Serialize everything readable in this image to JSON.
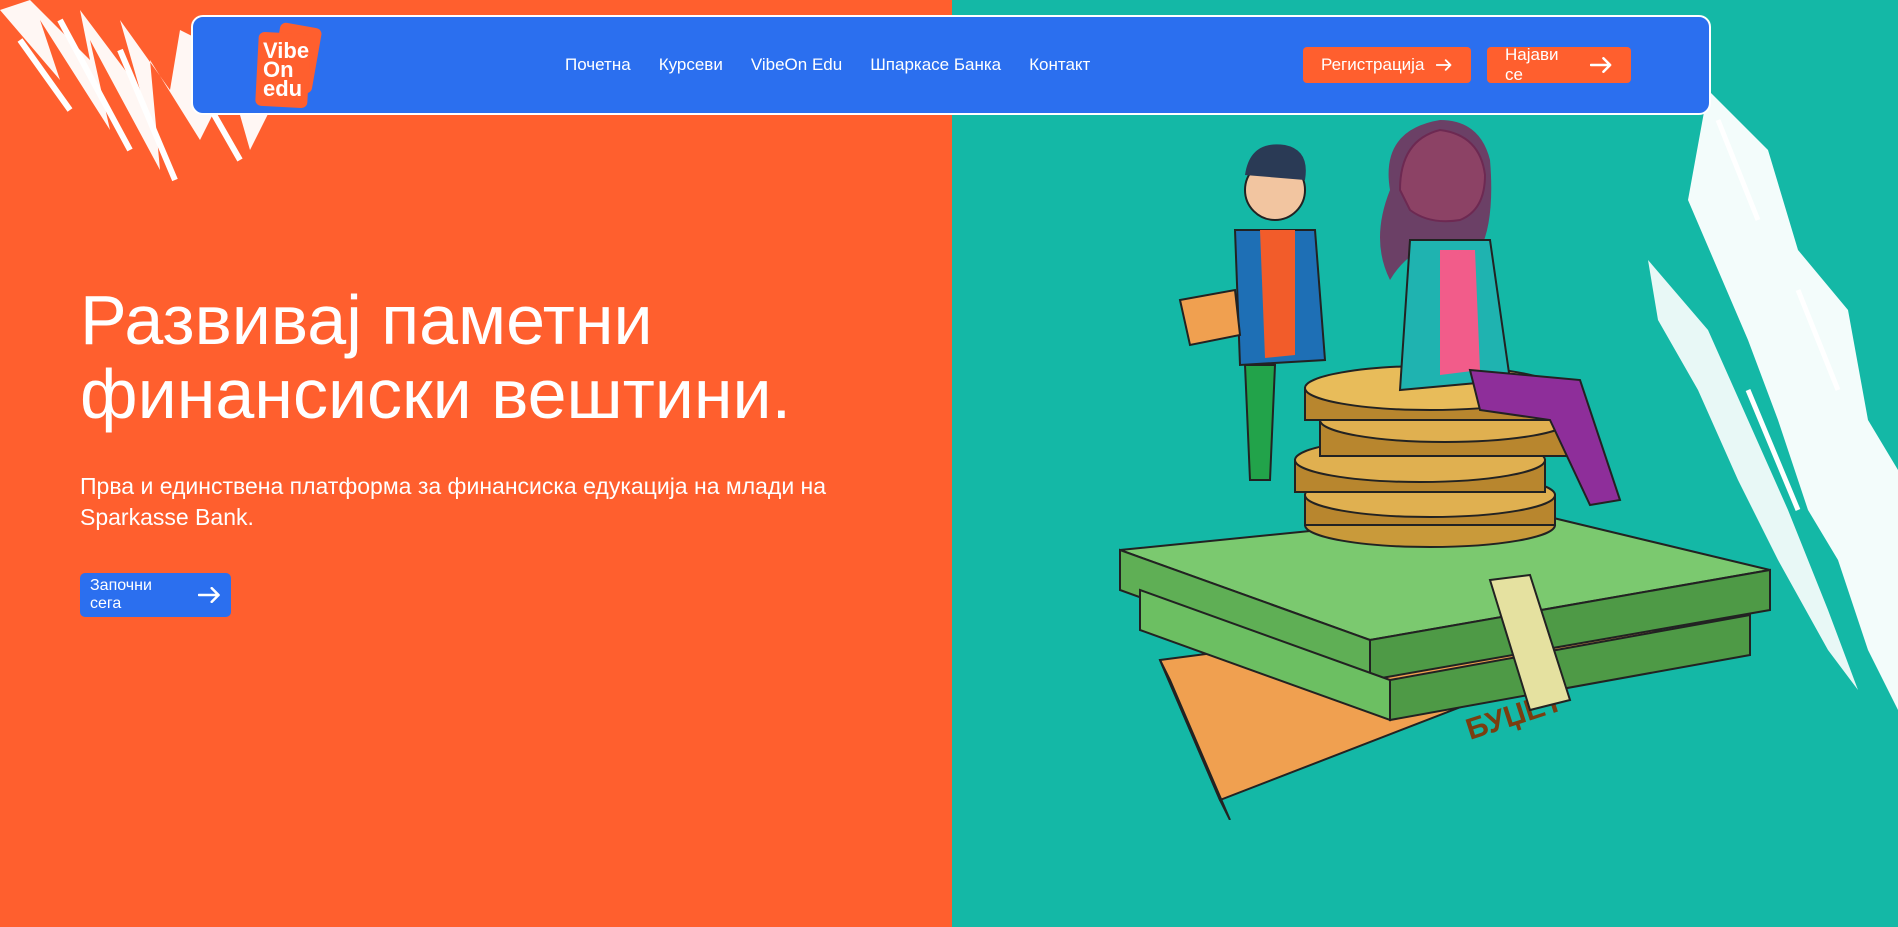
{
  "colors": {
    "left_bg": "#FF5F2E",
    "right_bg": "#14B8A6",
    "nav_bg": "#2B6FEF",
    "accent_orange": "#FF5F2E",
    "accent_blue": "#2B6FEF"
  },
  "logo": {
    "text": "Vibe\nOn\nedu"
  },
  "nav": {
    "links": [
      "Почетна",
      "Курсеви",
      "VibeOn Edu",
      "Шпаркасе Банка",
      "Контакт"
    ],
    "register_label": "Регистрација",
    "login_label": "Најави се"
  },
  "hero": {
    "title": "Развивај паметни финансиски вештини.",
    "subtitle": "Прва и единствена платформа за финансиска едукација на млади на Sparkasse Bank.",
    "cta_label": "Започни сега"
  },
  "illustration": {
    "budget_label": "БУЏЕТ",
    "icons": [
      "person-icon",
      "coin-stack-icon",
      "money-stack-icon"
    ]
  }
}
